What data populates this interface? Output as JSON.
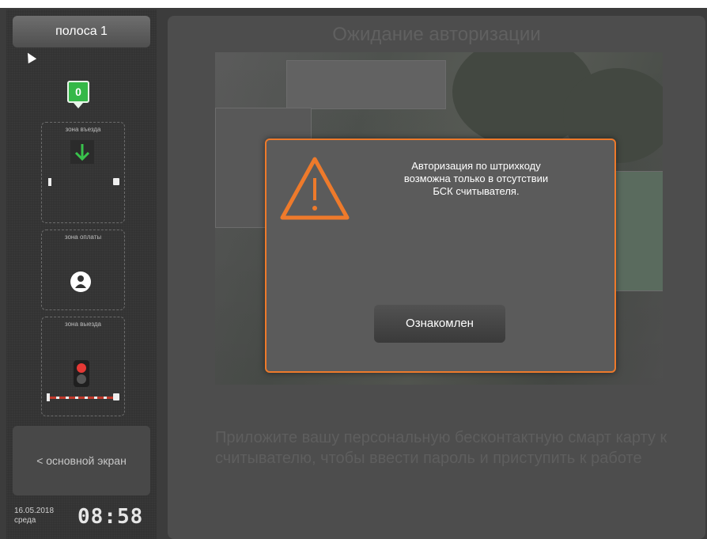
{
  "sidebar": {
    "lane_button": "полоса 1",
    "counter": "0",
    "zones": [
      {
        "label": "зона въезда"
      },
      {
        "label": "зона оплаты"
      },
      {
        "label": "зона выезда"
      }
    ],
    "main_screen_button": "< основной экран",
    "date": "16.05.2018",
    "weekday": "среда",
    "time": "08:58"
  },
  "main": {
    "status_title": "Ожидание авторизации",
    "instruction": "Приложите вашу персональную бесконтактную смарт карту к считывателю, чтобы ввести пароль и приступить к работе"
  },
  "dialog": {
    "message": "Авторизация по штрихкоду\nвозможна только в отсутствии\nБСК считывателя.",
    "confirm_button": "Ознакомлен"
  },
  "colors": {
    "accent_orange": "#ee7a2b",
    "counter_green": "#35b848",
    "red_light": "#e53935"
  },
  "icons": [
    "cursor-icon",
    "arrow-down-icon",
    "person-icon",
    "traffic-light-icon",
    "warning-icon",
    "lock-icon"
  ]
}
